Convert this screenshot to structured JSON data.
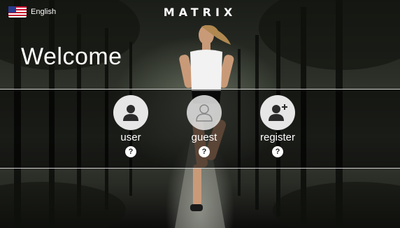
{
  "header": {
    "language_label": "English",
    "language_icon": "us-flag-icon",
    "brand": "MATRIX"
  },
  "main": {
    "welcome": "Welcome"
  },
  "login_options": [
    {
      "label": "user",
      "icon": "user-icon",
      "help": "?"
    },
    {
      "label": "guest",
      "icon": "guest-icon",
      "help": "?"
    },
    {
      "label": "register",
      "icon": "add-user-icon",
      "help": "?"
    }
  ],
  "colors": {
    "band_border": "#ffffff",
    "avatar_bg": "#e6e6e6",
    "icon_fill": "#2b2b2b"
  }
}
